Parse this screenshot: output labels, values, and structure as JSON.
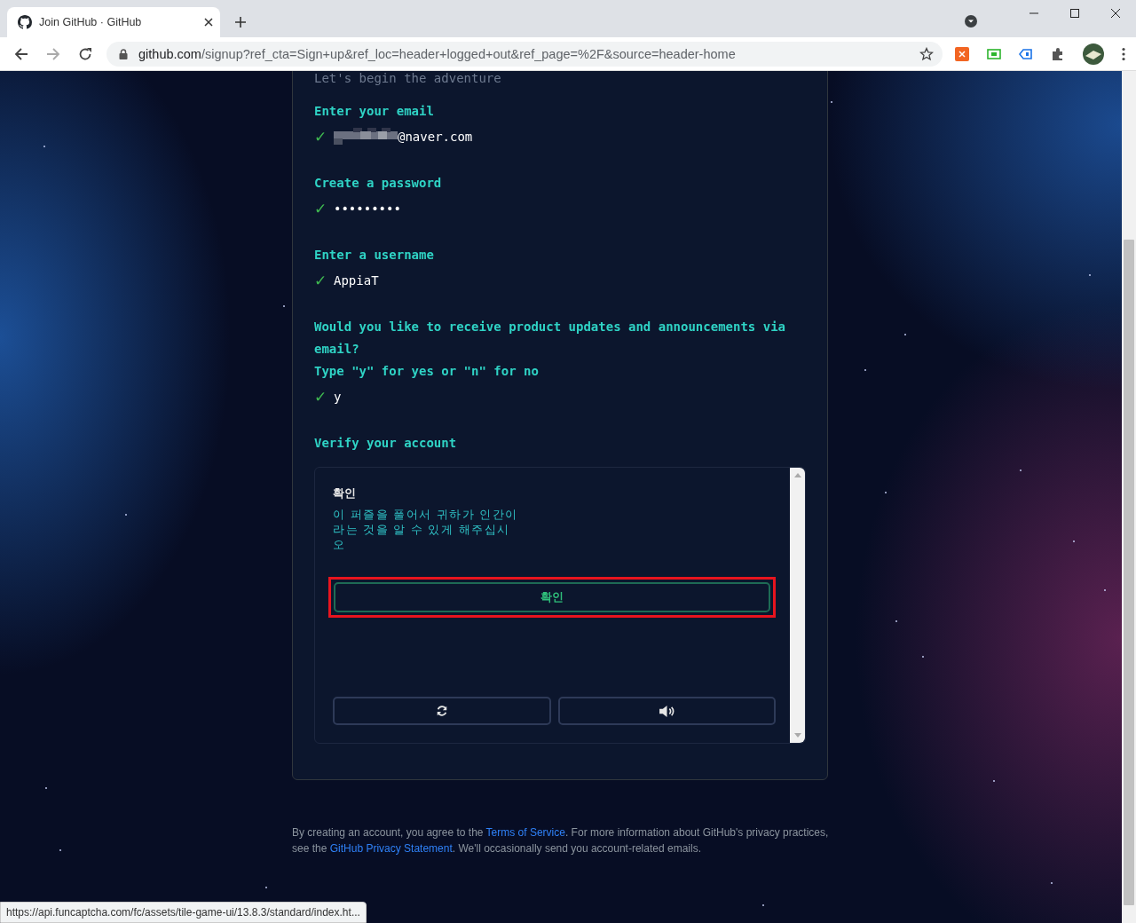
{
  "browser": {
    "tabs": [
      {
        "title": "Join GitHub · GitHub",
        "selected": true
      }
    ],
    "url_host": "github.com",
    "url_path": "/signup?ref_cta=Sign+up&ref_loc=header+logged+out&ref_page=%2F&source=header-home",
    "status_url": "https://api.funcaptcha.com/fc/assets/tile-game-ui/13.8.3/standard/index.ht..."
  },
  "signup": {
    "tagline": "Let's begin the adventure",
    "steps": [
      {
        "prompt": [
          "Enter your email"
        ],
        "check": "✓",
        "value": "@naver.com",
        "redacted": true
      },
      {
        "prompt": [
          "Create a password"
        ],
        "check": "✓",
        "value": "•••••••••"
      },
      {
        "prompt": [
          "Enter a username"
        ],
        "check": "✓",
        "value": "AppiaT"
      },
      {
        "prompt": [
          "Would you like to receive product updates and announcements via email?",
          "Type \"y\" for yes or \"n\" for no"
        ],
        "check": "✓",
        "value": "y"
      }
    ],
    "verify_label": "Verify your account",
    "captcha": {
      "heading": "확인",
      "instructions": "이 퍼즐을 풀어서 귀하가 인간이라는 것을 알 수 있게 해주십시오",
      "button": "확인",
      "highlighted": true
    }
  },
  "footer": [
    {
      "kind": "text",
      "text": "By creating an account, you agree to the "
    },
    {
      "kind": "link",
      "text": "Terms of Service"
    },
    {
      "kind": "text",
      "text": ". For more information about GitHub's privacy practices, see the "
    },
    {
      "kind": "link",
      "text": "GitHub Privacy Statement"
    },
    {
      "kind": "text",
      "text": ". We'll occasionally send you account-related emails."
    }
  ]
}
